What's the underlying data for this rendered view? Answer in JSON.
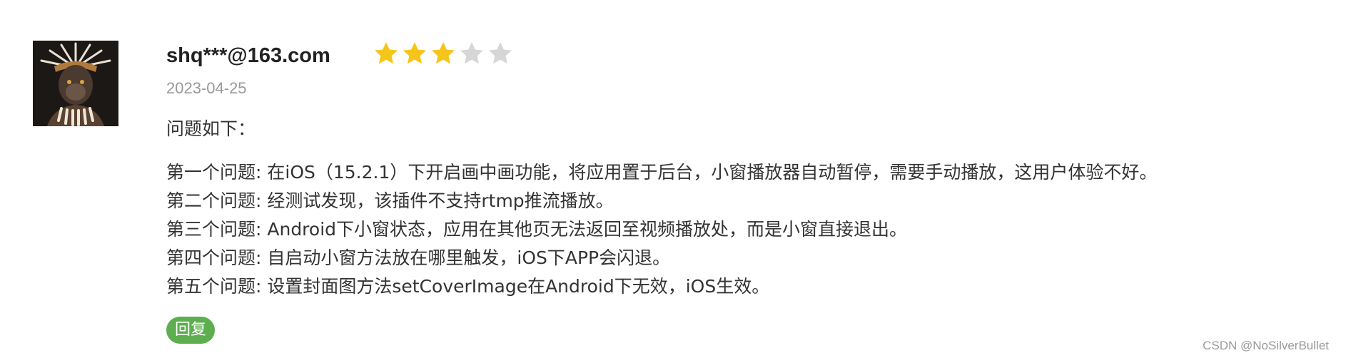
{
  "review": {
    "username": "shq***@163.com",
    "rating": {
      "value": 3,
      "max": 5,
      "filled_color": "#f6c51b",
      "empty_color": "#d6d6d6"
    },
    "date": "2023-04-25",
    "intro": "问题如下：",
    "issues": [
      "第一个问题: 在iOS（15.2.1）下开启画中画功能，将应用置于后台，小窗播放器自动暂停，需要手动播放，这用户体验不好。",
      "第二个问题: 经测试发现，该插件不支持rtmp推流播放。",
      "第三个问题: Android下小窗状态，应用在其他页无法返回至视频播放处，而是小窗直接退出。",
      "第四个问题: 自启动小窗方法放在哪里触发，iOS下APP会闪退。",
      "第五个问题: 设置封面图方法setCoverImage在Android下无效，iOS生效。"
    ],
    "reply_label": "回复",
    "reply_color": "#5cae4f",
    "avatar_icon": "tribal-monkey-avatar"
  },
  "watermark": "CSDN @NoSilverBullet"
}
